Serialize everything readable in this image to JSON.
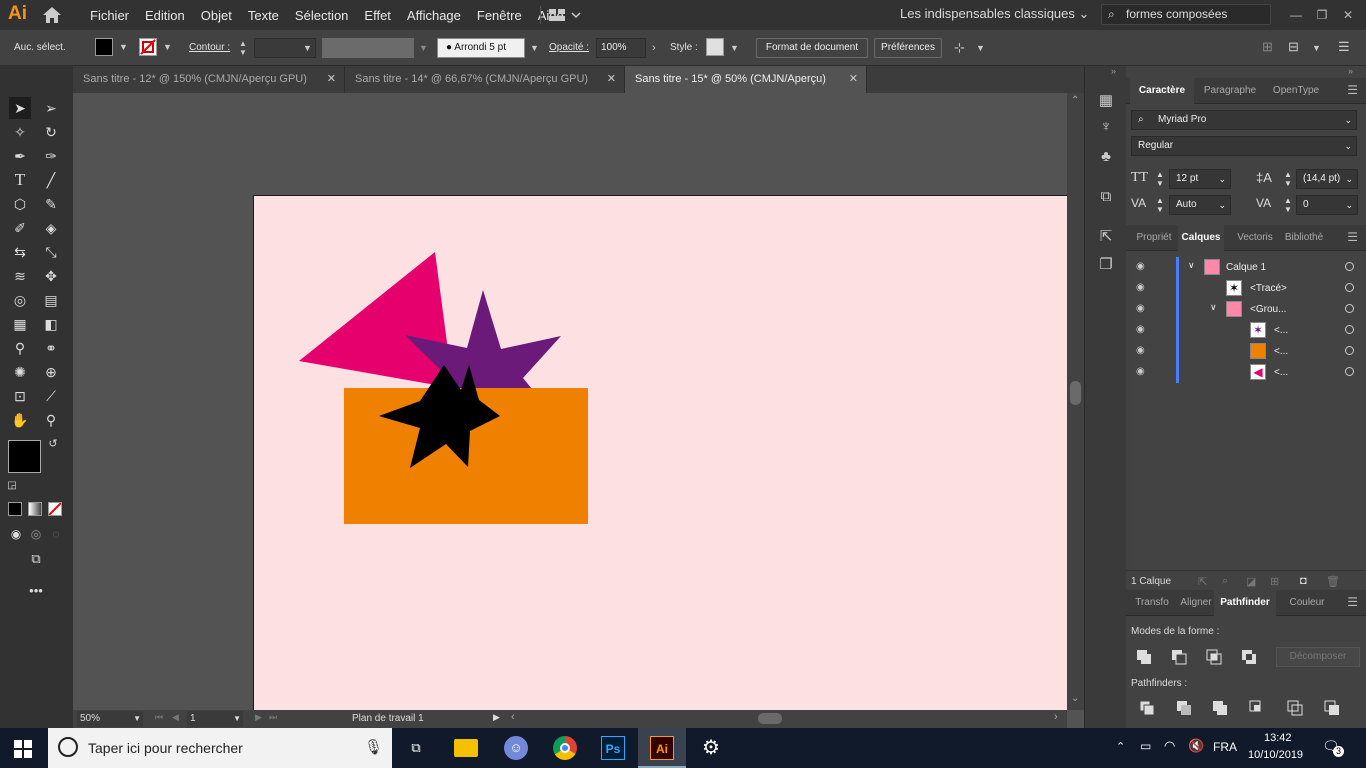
{
  "app": {
    "logo": "Ai"
  },
  "menubar": {
    "items": [
      "Fichier",
      "Edition",
      "Objet",
      "Texte",
      "Sélection",
      "Effet",
      "Affichage",
      "Fenêtre",
      "Aide"
    ],
    "workspace": "Les indispensables classiques",
    "search_value": "formes composées"
  },
  "control_bar": {
    "selection_label": "Auc. sélect.",
    "stroke_label": "Contour :",
    "brush_label": "Arrondi 5 pt",
    "opacity_label": "Opacité :",
    "opacity_value": "100%",
    "style_label": "Style :",
    "doc_setup_button": "Format de document",
    "preferences_button": "Préférences"
  },
  "tabs": [
    {
      "label": "Sans titre - 12* @ 150% (CMJN/Aperçu GPU)",
      "active": false
    },
    {
      "label": "Sans titre - 14* @ 66,67% (CMJN/Aperçu GPU)",
      "active": false
    },
    {
      "label": "Sans titre - 15* @ 50% (CMJN/Aperçu)",
      "active": true
    }
  ],
  "artwork": {
    "artboard_color": "#fde0e1",
    "triangle_color": "#e6006e",
    "star_purple_color": "#6b1a7a",
    "rect_color": "#f08000",
    "star_black_color": "#000000"
  },
  "status": {
    "zoom": "50%",
    "page": "1",
    "artboard_label": "Plan de travail 1"
  },
  "character_panel": {
    "tabs": [
      "Caractère",
      "Paragraphe",
      "OpenType"
    ],
    "font": "Myriad Pro",
    "style": "Regular",
    "size": "12 pt",
    "leading": "(14,4 pt)",
    "kerning": "Auto",
    "tracking": "0"
  },
  "layers_panel": {
    "tabs": [
      "Propriét",
      "Calques",
      "Vectoris",
      "Bibliothè"
    ],
    "rows": [
      {
        "name": "Calque 1"
      },
      {
        "name": "<Tracé>"
      },
      {
        "name": "<Grou..."
      },
      {
        "name": "<..."
      },
      {
        "name": "<..."
      },
      {
        "name": "<..."
      }
    ],
    "footer": "1 Calque"
  },
  "pathfinder_panel": {
    "tabs": [
      "Transfo",
      "Aligner",
      "Pathfinder",
      "Couleur"
    ],
    "shape_modes_label": "Modes de la forme :",
    "expand_button": "Décomposer",
    "pathfinders_label": "Pathfinders :"
  },
  "taskbar": {
    "search_placeholder": "Taper ici pour rechercher",
    "language": "FRA",
    "time": "13:42",
    "date": "10/10/2019",
    "notifications": "3"
  }
}
